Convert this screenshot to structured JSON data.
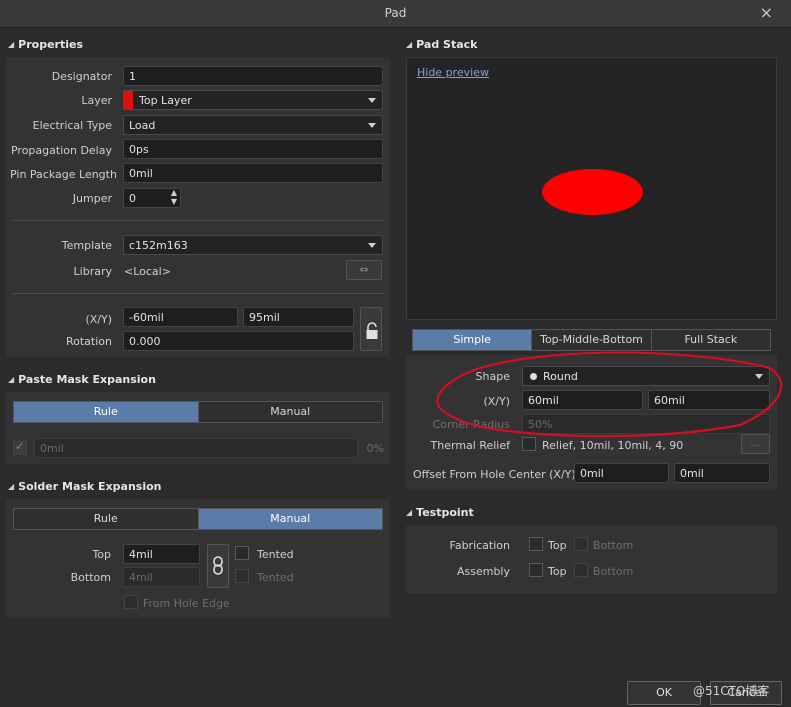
{
  "window": {
    "title": "Pad",
    "close_glyph": "×"
  },
  "properties": {
    "header": "Properties",
    "designator_label": "Designator",
    "designator_value": "1",
    "layer_label": "Layer",
    "layer_value": "Top Layer",
    "layer_color": "#e01010",
    "electrical_type_label": "Electrical Type",
    "electrical_type_value": "Load",
    "propagation_delay_label": "Propagation Delay",
    "propagation_delay_value": "0ps",
    "pin_package_length_label": "Pin Package Length",
    "pin_package_length_value": "0mil",
    "jumper_label": "Jumper",
    "jumper_value": "0",
    "template_label": "Template",
    "template_value": "c152m163",
    "library_label": "Library",
    "library_value": "<Local>",
    "xy_label": "(X/Y)",
    "x_value": "-60mil",
    "y_value": "95mil",
    "rotation_label": "Rotation",
    "rotation_value": "0.000"
  },
  "paste_mask": {
    "header": "Paste Mask Expansion",
    "tabs": [
      "Rule",
      "Manual"
    ],
    "active_tab": "Rule",
    "value": "0mil",
    "percent": "0%"
  },
  "solder_mask": {
    "header": "Solder Mask Expansion",
    "tabs": [
      "Rule",
      "Manual"
    ],
    "active_tab": "Manual",
    "top_label": "Top",
    "top_value": "4mil",
    "bottom_label": "Bottom",
    "bottom_value": "4mil",
    "tented_top_label": "Tented",
    "tented_bottom_label": "Tented",
    "from_hole_edge_label": "From Hole Edge"
  },
  "pad_stack": {
    "header": "Pad Stack",
    "hide_preview_label": "Hide preview",
    "preview_pad_color": "#ff0000",
    "tabs": [
      "Simple",
      "Top-Middle-Bottom",
      "Full Stack"
    ],
    "active_tab": "Simple",
    "shape_label": "Shape",
    "shape_value": "Round",
    "xy_label": "(X/Y)",
    "x_value": "60mil",
    "y_value": "60mil",
    "corner_radius_label": "Corner Radius",
    "corner_radius_value": "50%",
    "thermal_relief_label": "Thermal Relief",
    "thermal_relief_value": "Relief, 10mil, 10mil, 4, 90",
    "thermal_relief_button": "...",
    "offset_label": "Offset From Hole Center (X/Y)",
    "offset_x_value": "0mil",
    "offset_y_value": "0mil"
  },
  "testpoint": {
    "header": "Testpoint",
    "fabrication_label": "Fabrication",
    "assembly_label": "Assembly",
    "top_label": "Top",
    "bottom_label": "Bottom"
  },
  "footer": {
    "ok_label": "OK",
    "cancel_label": "Cancel"
  },
  "watermark": "@51CTO博客",
  "colors": {
    "accent": "#5b7ba8",
    "annotation": "#d01020"
  }
}
